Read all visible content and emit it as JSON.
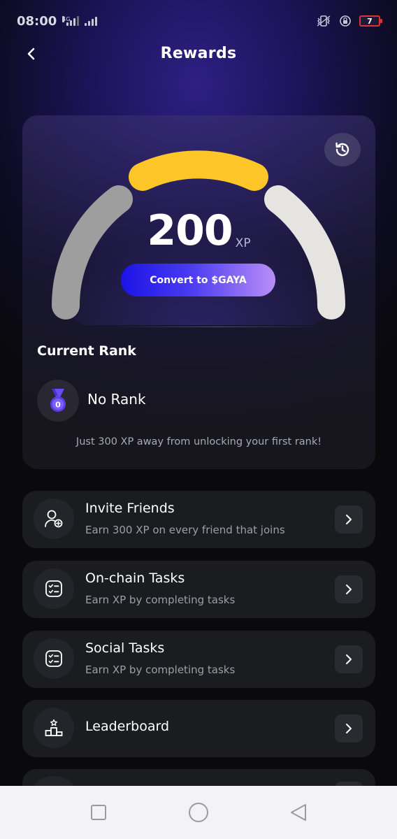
{
  "status_bar": {
    "time": "08:00",
    "network": "4G",
    "battery": "7"
  },
  "header": {
    "title": "Rewards"
  },
  "xp_card": {
    "xp_value": "200",
    "xp_unit": "XP",
    "convert_label": "Convert to $GAYA",
    "current_rank_label": "Current Rank",
    "rank_badge_number": "0",
    "rank_name": "No Rank",
    "rank_hint": "Just 300 XP away from unlocking your first rank!"
  },
  "gauge": {
    "segments": [
      "grey",
      "yellow",
      "light"
    ],
    "colors": {
      "grey": "#9e9e9e",
      "yellow": "#ffc62a",
      "light": "#e6e4e1"
    }
  },
  "tasks": [
    {
      "title": "Invite Friends",
      "subtitle": "Earn 300 XP on every friend that joins",
      "icon": "add-user-icon"
    },
    {
      "title": "On-chain Tasks",
      "subtitle": "Earn XP by completing tasks",
      "icon": "checklist-icon"
    },
    {
      "title": "Social Tasks",
      "subtitle": "Earn XP by completing tasks",
      "icon": "checklist-icon"
    },
    {
      "title": "Leaderboard",
      "subtitle": "",
      "icon": "podium-icon"
    }
  ],
  "colors": {
    "accent_start": "#1b14e6",
    "accent_end": "#b98ef7",
    "card_bg": "#1b1c1f"
  }
}
